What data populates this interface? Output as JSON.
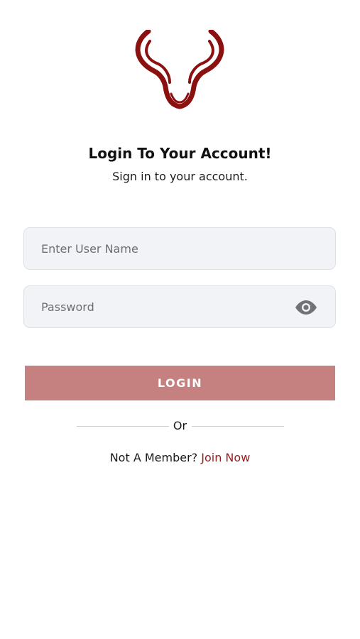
{
  "logo": {
    "icon": "bull-head-logo",
    "color": "#8b1010"
  },
  "header": {
    "title": "Login To Your Account!",
    "subtitle": "Sign in to your account."
  },
  "form": {
    "username": {
      "placeholder": "Enter User Name",
      "value": ""
    },
    "password": {
      "placeholder": "Password",
      "value": "",
      "toggle_icon": "eye-icon"
    },
    "login_label": "LOGIN"
  },
  "divider": {
    "label": "Or"
  },
  "footer": {
    "prompt": "Not A Member?",
    "join_label": "Join Now"
  },
  "colors": {
    "brand": "#8b1010",
    "button": "#c5817f",
    "link": "#9e1b1b",
    "field_bg": "#f1f3f6"
  }
}
